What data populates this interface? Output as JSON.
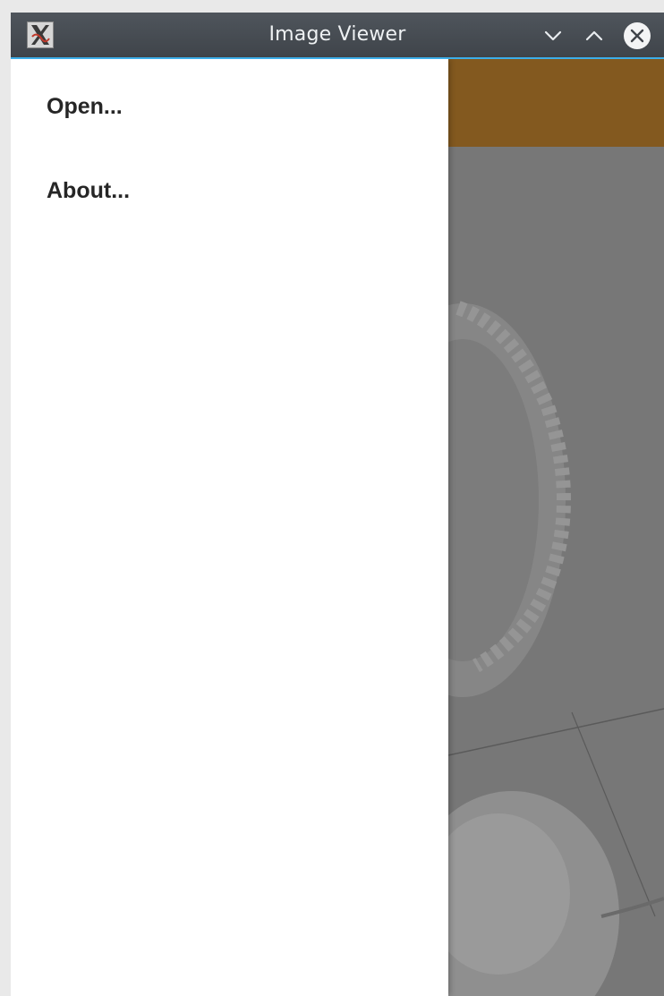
{
  "window": {
    "title": "Image Viewer",
    "app_icon": "x11-app-icon",
    "controls": {
      "minimize_icon": "chevron-down-icon",
      "maximize_icon": "chevron-up-icon",
      "close_icon": "close-circle-icon"
    }
  },
  "drawer": {
    "items": [
      {
        "label": "Open..."
      },
      {
        "label": "About..."
      }
    ]
  },
  "colors": {
    "titlebar": "#474c52",
    "titlebar_accent": "#3daee9",
    "toolbar": "#83591f",
    "drawer_bg": "#ffffff",
    "menu_text": "#262626"
  }
}
